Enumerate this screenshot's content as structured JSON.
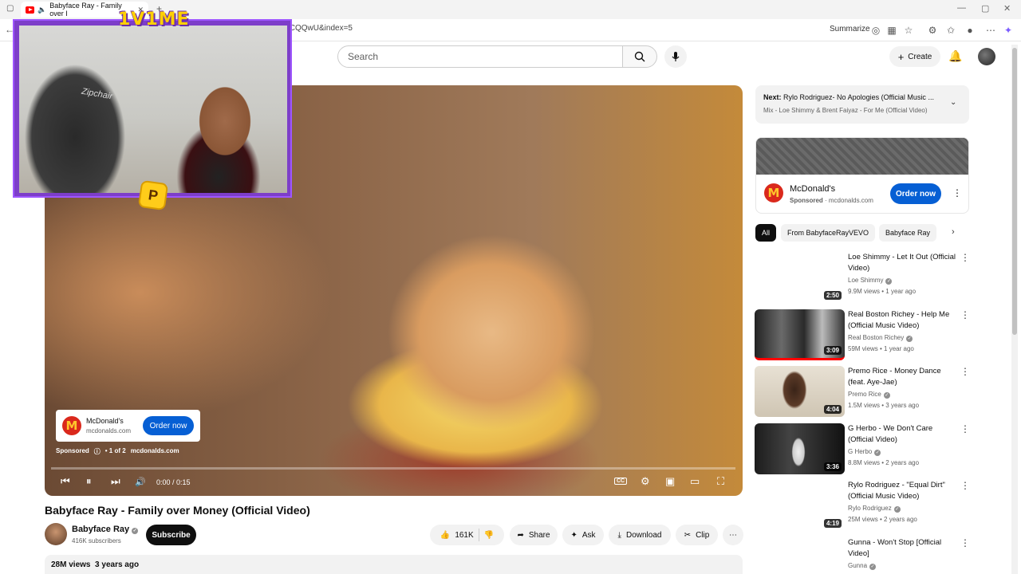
{
  "browser": {
    "tab_title": "Babyface Ray - Family over I",
    "url_fragment": "fCQQwU&index=5",
    "summarize": "Summarize"
  },
  "header": {
    "search_placeholder": "Search",
    "create_label": "Create"
  },
  "stream_overlay": {
    "title": "1V1ME",
    "badge": "P",
    "chair_brand": "Zipchair"
  },
  "player": {
    "ad": {
      "advertiser": "McDonald's",
      "domain": "mcdonalds.com",
      "cta": "Order now",
      "sponsored": "Sponsored",
      "ad_count": "• 1 of 2",
      "ad_domain": "mcdonalds.com"
    },
    "time": "0:00 / 0:15",
    "progress_fraction": 0.0,
    "cc_label": "CC"
  },
  "video": {
    "title": "Babyface Ray - Family over Money (Official Video)",
    "channel": "Babyface Ray",
    "subscribers": "416K subscribers",
    "subscribe_label": "Subscribe",
    "likes": "161K",
    "share": "Share",
    "ask": "Ask",
    "download": "Download",
    "clip": "Clip",
    "views": "28M views",
    "age": "3 years ago"
  },
  "sidebar": {
    "next_prefix": "Next:",
    "next_title": "Rylo Rodriguez- No Apologies (Official Music ...",
    "next_mix": "Mix - Loe Shimmy & Brent Faiyaz - For Me (Official Video)",
    "ad": {
      "advertiser": "McDonald's",
      "sponsored": "Sponsored",
      "domain": "mcdonalds.com",
      "cta": "Order now"
    },
    "chips": [
      "All",
      "From BabyfaceRayVEVO",
      "Babyface Ray"
    ],
    "recommendations": [
      {
        "title": "Loe Shimmy - Let It Out (Official Video)",
        "channel": "Loe Shimmy",
        "views": "9.9M views",
        "age": "1 year ago",
        "duration": "2:50"
      },
      {
        "title": "Real Boston Richey - Help Me (Official Music Video)",
        "channel": "Real Boston Richey",
        "views": "59M views",
        "age": "1 year ago",
        "duration": "3:09"
      },
      {
        "title": "Premo Rice - Money Dance (feat. Aye-Jae)",
        "channel": "Premo Rice",
        "views": "1.5M views",
        "age": "3 years ago",
        "duration": "4:04"
      },
      {
        "title": "G Herbo - We Don't Care (Official Video)",
        "channel": "G Herbo",
        "views": "8.8M views",
        "age": "2 years ago",
        "duration": "3:36"
      },
      {
        "title": "Rylo Rodriguez - \"Equal Dirt\" (Official Music Video)",
        "channel": "Rylo Rodriguez",
        "views": "25M views",
        "age": "2 years ago",
        "duration": "4:19"
      },
      {
        "title": "Gunna - Won't Stop [Official Video]",
        "channel": "Gunna",
        "views": "",
        "age": "",
        "duration": ""
      }
    ]
  },
  "colors": {
    "accent_red": "#ff0000",
    "button_blue": "#065fd4",
    "overlay_purple": "#7d3ec9",
    "overlay_yellow": "#ffd000"
  }
}
